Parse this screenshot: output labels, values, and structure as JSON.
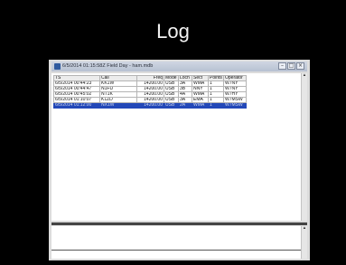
{
  "slide": {
    "title": "Log"
  },
  "window": {
    "title": "6/5/2014 01:15:58Z  Field Day - ham.mdb"
  },
  "window_controls": {
    "minimize": "–",
    "maximize": "□",
    "close": "×"
  },
  "table": {
    "columns": [
      "TS",
      "Call",
      "Freq",
      "Mode",
      "Loch",
      "Sect",
      "Points",
      "Operator"
    ],
    "rows": [
      [
        "6/5/2014 00:44:23",
        "KK1W",
        "14200.00",
        "USB",
        "3A",
        "WMA",
        "1",
        "W7NY"
      ],
      [
        "6/5/2014 00:44:47",
        "N1FU",
        "14200.00",
        "USB",
        "3B",
        "NNY",
        "1",
        "W7NY"
      ],
      [
        "6/5/2014 00:45:02",
        "NT1K",
        "14200.00",
        "USB",
        "4A",
        "WMA",
        "1",
        "W7HY"
      ],
      [
        "6/5/2014 01:10:07",
        "K1ZD",
        "14200.00",
        "USB",
        "3A",
        "EMA",
        "1",
        "W7MSW"
      ],
      [
        "6/5/2014 01:12:00",
        "NX1W",
        "14200.00",
        "USB",
        "2A",
        "WMA",
        "1",
        "W7MSW"
      ]
    ],
    "selected_row": 4
  }
}
